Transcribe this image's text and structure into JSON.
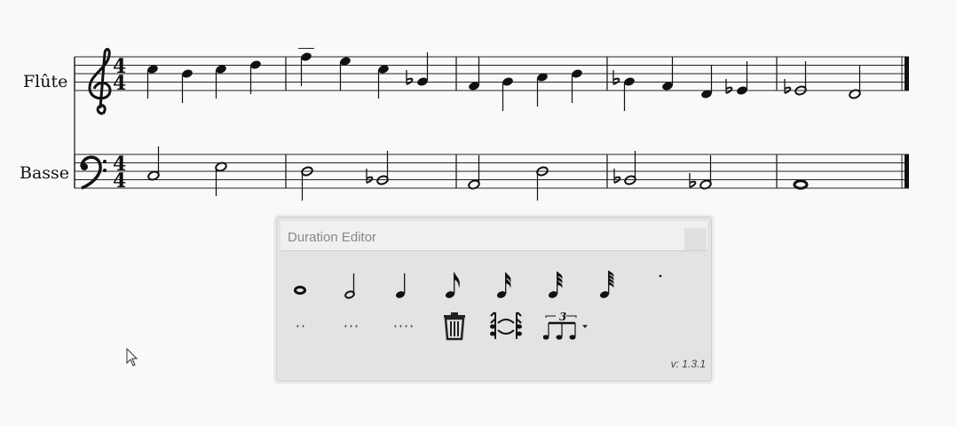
{
  "score": {
    "staves": [
      {
        "name": "Flûte",
        "clef": "treble",
        "time_signature": "4/4"
      },
      {
        "name": "Basse",
        "clef": "bass",
        "time_signature": "4/4"
      }
    ]
  },
  "duration_editor": {
    "title": "Duration Editor",
    "version": "v: 1.3.1",
    "row1": [
      "whole-note-icon",
      "half-note-icon",
      "quarter-note-icon",
      "eighth-note-icon",
      "sixteenth-note-icon",
      "thirty-second-note-icon",
      "sixty-fourth-note-icon",
      "dot-icon"
    ],
    "row2": {
      "double_dot": "··",
      "triple_dot": "···",
      "quadruple_dot": "····",
      "delete_icon": "trash-icon",
      "tie_icon": "tie-icon",
      "tuplet_icon": "tuplet-icon",
      "tuplet_number": "3"
    }
  }
}
